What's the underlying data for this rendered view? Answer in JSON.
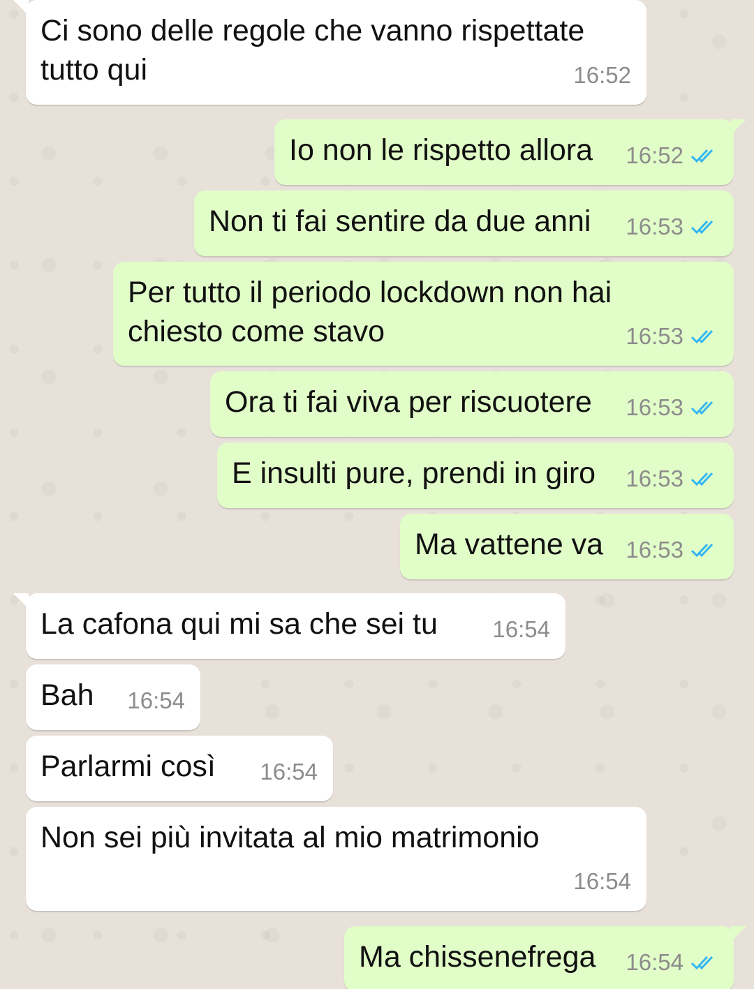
{
  "colors": {
    "incoming_bubble": "#ffffff",
    "outgoing_bubble": "#e1fdc8",
    "read_ticks": "#34b7f1",
    "timestamp": "#8c8c8c",
    "chat_background": "#e8e1da"
  },
  "messages": [
    {
      "direction": "incoming",
      "lines": [
        "Ci sono delle regole che vanno rispettate",
        "tutto qui"
      ],
      "time": "16:52"
    },
    {
      "direction": "outgoing",
      "lines": [
        "Io non le rispetto allora"
      ],
      "time": "16:52",
      "status_icon": "double-check-read-icon"
    },
    {
      "direction": "outgoing",
      "lines": [
        "Non ti fai sentire da due anni"
      ],
      "time": "16:53",
      "status_icon": "double-check-read-icon"
    },
    {
      "direction": "outgoing",
      "lines": [
        "Per tutto il periodo lockdown non hai",
        "chiesto come stavo"
      ],
      "time": "16:53",
      "status_icon": "double-check-read-icon"
    },
    {
      "direction": "outgoing",
      "lines": [
        "Ora ti fai viva per riscuotere"
      ],
      "time": "16:53",
      "status_icon": "double-check-read-icon"
    },
    {
      "direction": "outgoing",
      "lines": [
        "E insulti pure, prendi in giro"
      ],
      "time": "16:53",
      "status_icon": "double-check-read-icon"
    },
    {
      "direction": "outgoing",
      "lines": [
        "Ma vattene va"
      ],
      "time": "16:53",
      "status_icon": "double-check-read-icon"
    },
    {
      "direction": "incoming",
      "lines": [
        "La cafona qui mi sa che sei tu"
      ],
      "time": "16:54"
    },
    {
      "direction": "incoming",
      "lines": [
        "Bah"
      ],
      "time": "16:54"
    },
    {
      "direction": "incoming",
      "lines": [
        "Parlarmi così"
      ],
      "time": "16:54"
    },
    {
      "direction": "incoming",
      "lines": [
        "Non sei più invitata al mio matrimonio"
      ],
      "time": "16:54"
    },
    {
      "direction": "outgoing",
      "lines": [
        "Ma chissenefrega"
      ],
      "time": "16:54",
      "status_icon": "double-check-read-icon"
    }
  ]
}
